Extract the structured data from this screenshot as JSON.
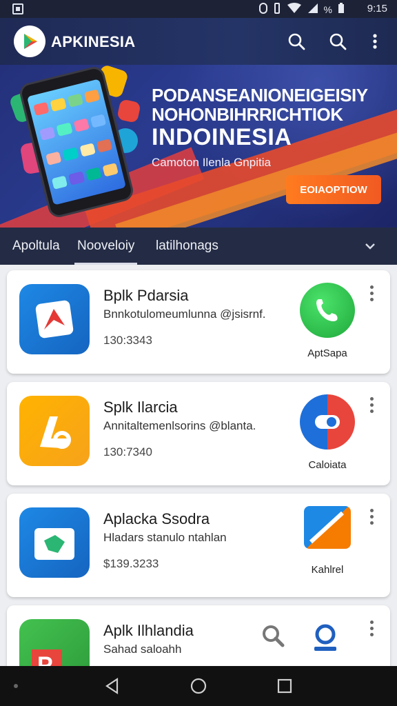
{
  "status_bar": {
    "time": "9:15",
    "battery_text": "%"
  },
  "app_bar": {
    "title": "APKINESIA"
  },
  "banner": {
    "headline_line1": "PODANSEANIONEIGEISIY",
    "headline_line2": "NOHONBIHRRICHTIOK",
    "headline_line3": "INDOINESIA",
    "subtitle": "Camoton Ilenla Gnpitia",
    "cta_label": "EOIAOPTIOW"
  },
  "tabs": [
    {
      "label": "Apoltula"
    },
    {
      "label": "Nooveloiy"
    },
    {
      "label": "latilhonags"
    }
  ],
  "apps": [
    {
      "title": "Bplk Pdarsia",
      "description": "Bnnkotulomeumlunna @jsisrnf.",
      "meta": "130:3343",
      "side_label": "AptSapa"
    },
    {
      "title": "Splk Ilarcia",
      "description": "Annitaltemenlsorins @blanta.",
      "meta": "130:7340",
      "side_label": "Caloiata"
    },
    {
      "title": "Aplacka Ssodra",
      "description": "Hladars stanulo ntahlan",
      "meta": "$139.3233",
      "side_label": "Kahlrel"
    },
    {
      "title": "Aplk Ilhlandia",
      "description": "Sahad saloahh",
      "meta": "",
      "side_label": ""
    }
  ],
  "colors": {
    "appbar": "#243466",
    "tabs": "#242c45",
    "cta": "#f15a22",
    "whatsapp_green": "#25c244"
  }
}
